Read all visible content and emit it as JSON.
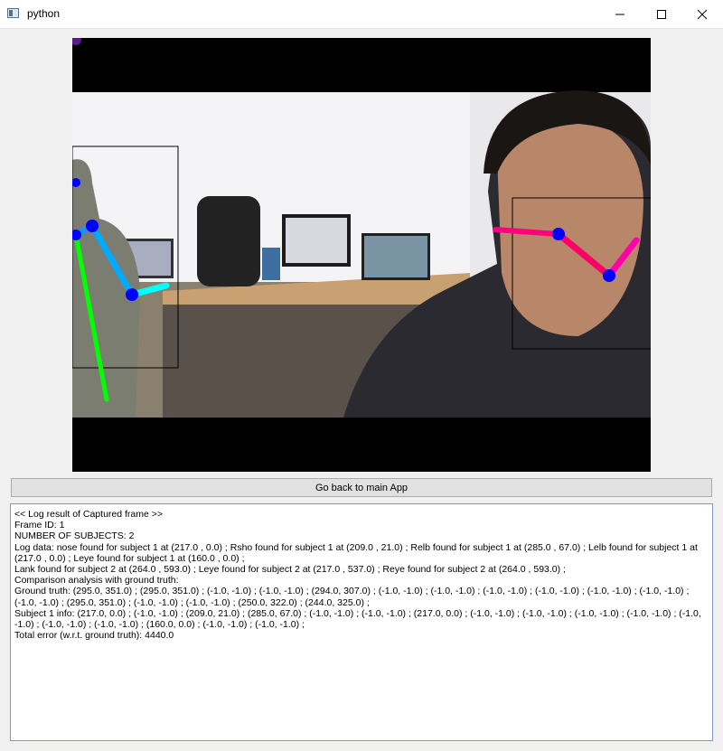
{
  "window": {
    "title": "python",
    "app_icon": "window-app-icon",
    "controls": [
      "minimize-icon",
      "maximize-icon",
      "close-icon"
    ]
  },
  "viewport": {
    "content": "camera frame with pose skeleton overlays and bounding boxes"
  },
  "buttons": {
    "go_back_label": "Go back to main App"
  },
  "log": {
    "lines": [
      "<< Log result of Captured frame >>",
      "Frame ID: 1",
      "NUMBER OF SUBJECTS: 2",
      "Log data: nose  found for subject 1 at (217.0 , 0.0) ; Rsho  found for subject 1 at (209.0 , 21.0) ; Relb  found for subject 1 at (285.0 , 67.0) ; Lelb  found for subject 1 at (217.0 , 0.0) ; Leye  found for subject 1 at (160.0 , 0.0) ;",
      "Lank  found for subject 2 at (264.0 , 593.0) ; Leye  found for subject 2 at (217.0 , 537.0) ; Reye  found for subject 2 at (264.0 , 593.0) ;",
      "Comparison analysis with ground truth:",
      "Ground truth: (295.0, 351.0) ; (295.0, 351.0) ; (-1.0, -1.0) ; (-1.0, -1.0) ; (294.0, 307.0) ; (-1.0, -1.0) ; (-1.0, -1.0) ; (-1.0, -1.0) ; (-1.0, -1.0) ; (-1.0, -1.0) ; (-1.0, -1.0) ; (-1.0, -1.0) ; (295.0, 351.0) ; (-1.0, -1.0) ; (-1.0, -1.0) ; (250.0, 322.0) ; (244.0, 325.0) ;",
      "Subject 1 info: (217.0, 0.0) ; (-1.0, -1.0) ; (209.0, 21.0) ; (285.0, 67.0) ; (-1.0, -1.0) ; (-1.0, -1.0) ; (217.0, 0.0) ; (-1.0, -1.0) ; (-1.0, -1.0) ; (-1.0, -1.0) ; (-1.0, -1.0) ; (-1.0, -1.0) ; (-1.0, -1.0) ; (-1.0, -1.0) ; (160.0, 0.0) ; (-1.0, -1.0) ; (-1.0, -1.0) ;",
      "Total error (w.r.t. ground truth): 4440.0"
    ]
  },
  "colors": {
    "title_bar": "#ffffff",
    "window_bg": "#f0f0f0",
    "log_border": "#7a9cbf",
    "keypoint": "#0000ff",
    "limb_green": "#00ff00",
    "limb_blue": "#00aaff",
    "limb_cyan": "#00ffff",
    "limb_magenta": "#ff0066",
    "limb_pink": "#ff00aa"
  }
}
